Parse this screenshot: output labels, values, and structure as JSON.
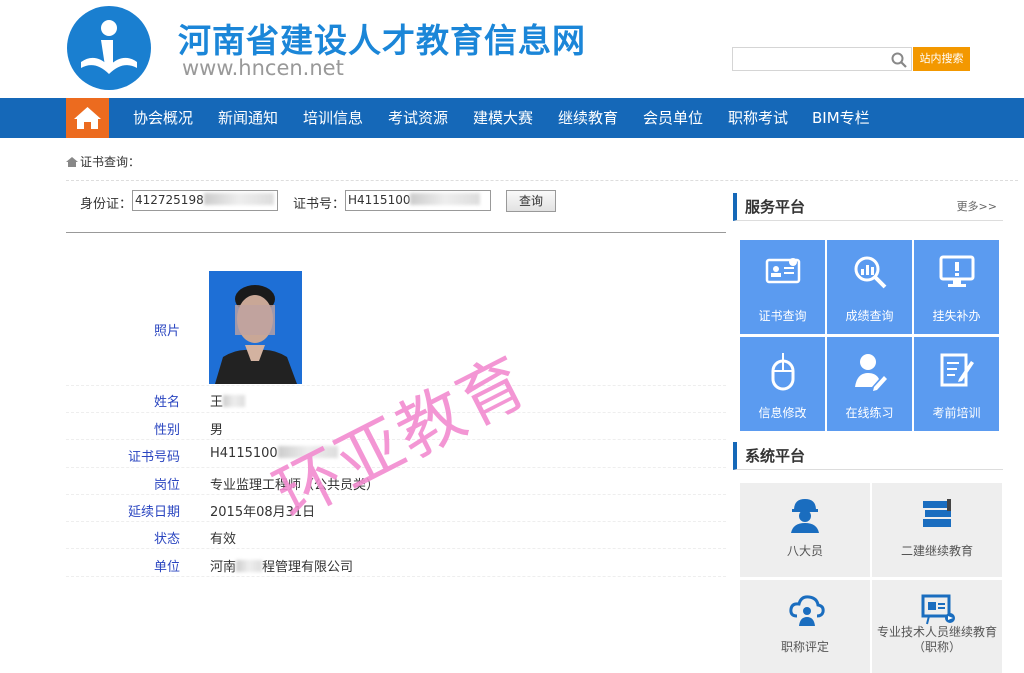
{
  "header": {
    "title": "河南省建设人才教育信息网",
    "url": "www.hncen.net",
    "search_button": "站内搜索",
    "search_value": ""
  },
  "nav": {
    "items": [
      "协会概况",
      "新闻通知",
      "培训信息",
      "考试资源",
      "建模大赛",
      "继续教育",
      "会员单位",
      "职称考试",
      "BIM专栏"
    ]
  },
  "breadcrumb": "证书查询：",
  "query": {
    "id_label": "身份证：",
    "id_value": "41272519​8",
    "cert_label": "证书号：",
    "cert_value": "H4115100",
    "button": "查询"
  },
  "record": {
    "photo_label": "照片",
    "name_label": "姓名",
    "name_value": "王",
    "gender_label": "性别",
    "gender_value": "男",
    "cert_no_label": "证书号码",
    "cert_no_value": "H4115100",
    "position_label": "岗位",
    "position_value": "专业监理工程师（公共员类）",
    "renew_label": "延续日期",
    "renew_value": "2015年08月31日",
    "status_label": "状态",
    "status_value": "有效",
    "unit_label": "单位",
    "unit_value_pre": "河南",
    "unit_value_post": "程管理有限公司"
  },
  "watermark": "环亚教育",
  "service_panel": {
    "title": "服务平台",
    "more": "更多>>",
    "items": [
      {
        "label": "证书查询",
        "icon": "certificate-icon"
      },
      {
        "label": "成绩查询",
        "icon": "chart-search-icon"
      },
      {
        "label": "挂失补办",
        "icon": "monitor-alert-icon"
      },
      {
        "label": "信息修改",
        "icon": "mouse-icon"
      },
      {
        "label": "在线练习",
        "icon": "user-edit-icon"
      },
      {
        "label": "考前培训",
        "icon": "document-edit-icon"
      }
    ]
  },
  "system_panel": {
    "title": "系统平台",
    "items": [
      {
        "label": "八大员",
        "icon": "worker-icon"
      },
      {
        "label": "二建继续教育",
        "icon": "books-icon"
      },
      {
        "label": "职称评定",
        "icon": "cloud-user-icon"
      },
      {
        "label": "专业技术人员继续教育（职称）",
        "icon": "presentation-icon"
      }
    ]
  },
  "colors": {
    "nav": "#1568b8",
    "home": "#ec6b1f",
    "search_button": "#f39800",
    "service_tile": "#5b9bf0",
    "watermark": "#f28bd0"
  }
}
